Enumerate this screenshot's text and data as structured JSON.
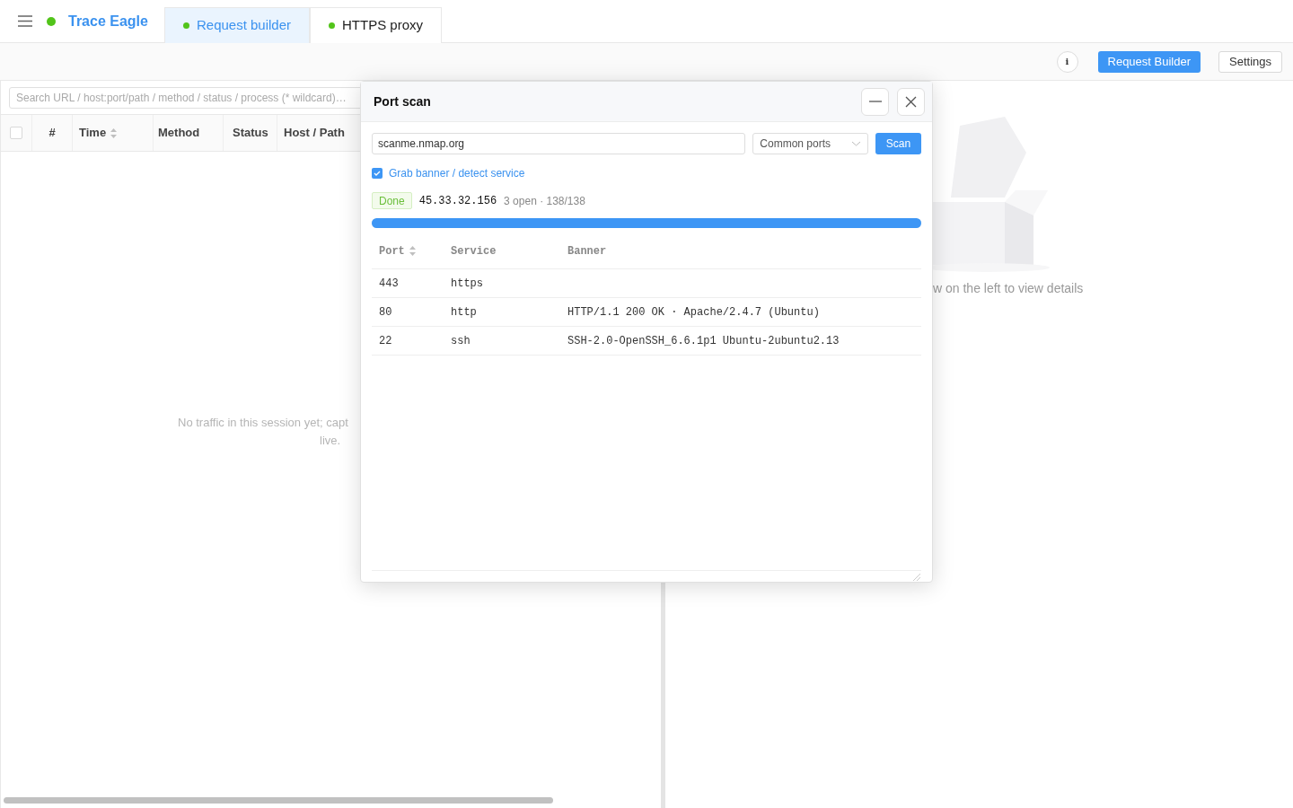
{
  "brand": {
    "name": "Trace Eagle"
  },
  "tabs": [
    {
      "label": "Request builder",
      "selected": true
    },
    {
      "label": "HTTPS proxy",
      "selected": false
    }
  ],
  "toolbar": {
    "info": "i",
    "buttons": [
      {
        "label": "Request Builder",
        "kind": "primary"
      },
      {
        "label": "Settings",
        "kind": "default"
      }
    ]
  },
  "search": {
    "placeholder": "Search URL / host:port/path / method / status / process (* wildcard)…"
  },
  "traffic_table": {
    "select_all": {
      "checked": false
    },
    "columns": [
      {
        "label": "#",
        "sortable": false
      },
      {
        "label": "Time",
        "sortable": true
      },
      {
        "label": "Method",
        "sortable": false
      },
      {
        "label": "Status",
        "sortable": false
      },
      {
        "label": "Host / Path",
        "sortable": false
      }
    ],
    "empty_message": [
      "No traffic in this session yet; capt",
      "live."
    ]
  },
  "detail_hint": "w on the left to view details",
  "port_scan": {
    "title": "Port scan",
    "target": "scanme.nmap.org",
    "port_set": "Common ports",
    "scan_button": "Scan",
    "grab_banner": {
      "label": "Grab banner / detect service",
      "checked": true
    },
    "status": "Done",
    "ip": "45.33.32.156",
    "summary": "3 open · 138/138",
    "progress": {
      "level": 1
    },
    "columns": [
      {
        "label": "Port",
        "sortable": true
      },
      {
        "label": "Service",
        "sortable": false
      },
      {
        "label": "Banner",
        "sortable": false
      }
    ],
    "rows": [
      {
        "port": "443",
        "service": "https"
      },
      {
        "port": "80",
        "service": "http",
        "banner": "HTTP/1.1 200 OK · Apache/2.4.7 (Ubuntu)"
      },
      {
        "port": "22",
        "service": "ssh",
        "banner": "SSH-2.0-OpenSSH_6.6.1p1 Ubuntu-2ubuntu2.13"
      }
    ]
  }
}
